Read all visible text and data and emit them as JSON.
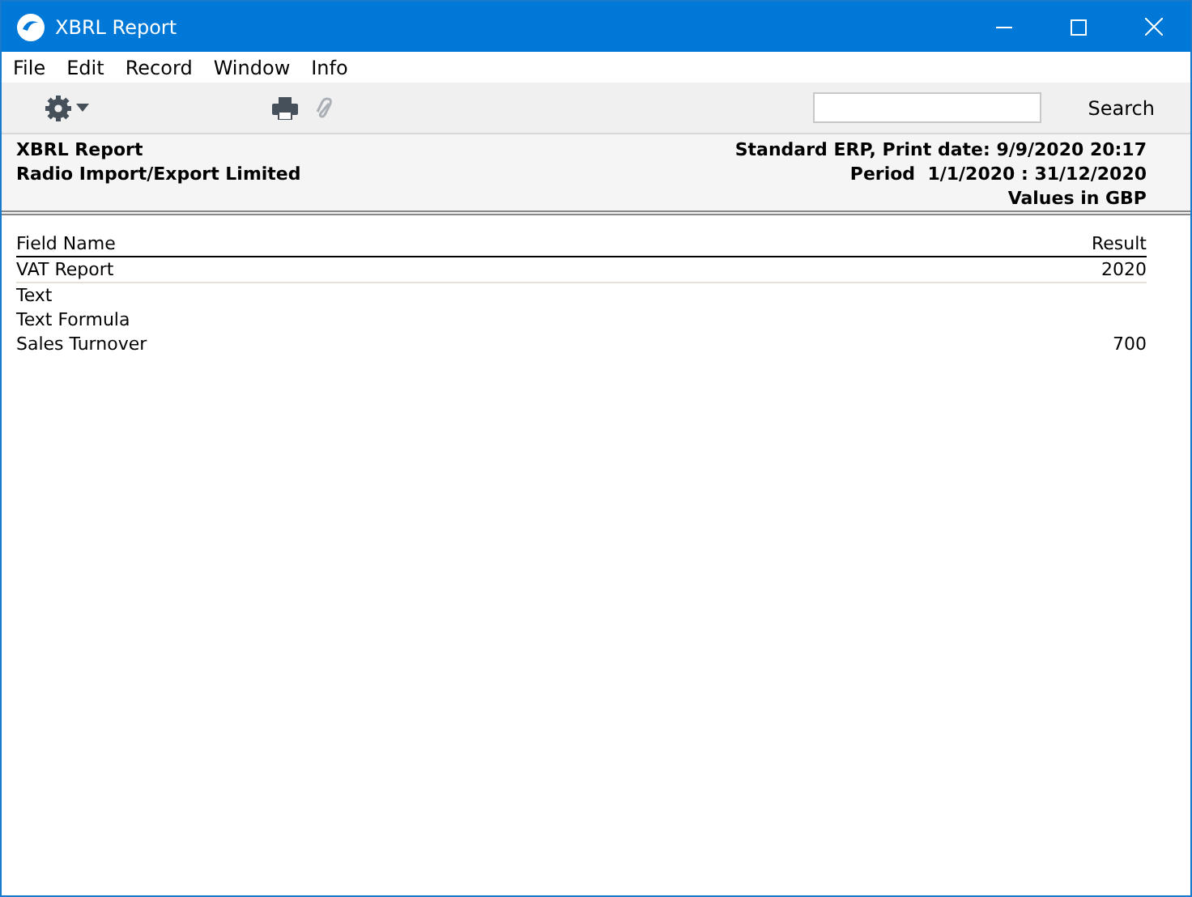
{
  "window": {
    "title": "XBRL Report"
  },
  "menu": [
    "File",
    "Edit",
    "Record",
    "Window",
    "Info"
  ],
  "toolbar": {
    "search_button": "Search"
  },
  "report_header": {
    "left": [
      "XBRL Report",
      "Radio Import/Export Limited"
    ],
    "right": [
      "Standard ERP, Print date: 9/9/2020 20:17",
      "Period  1/1/2020 : 31/12/2020",
      "Values in GBP"
    ]
  },
  "table": {
    "columns": [
      "Field Name",
      "Result"
    ],
    "rows": [
      {
        "field_name": "VAT Report",
        "result": "2020"
      },
      {
        "field_name": "Text"
      },
      {
        "field_name": "Text Formula"
      },
      {
        "field_name": "Sales Turnover",
        "result": "700"
      }
    ]
  }
}
